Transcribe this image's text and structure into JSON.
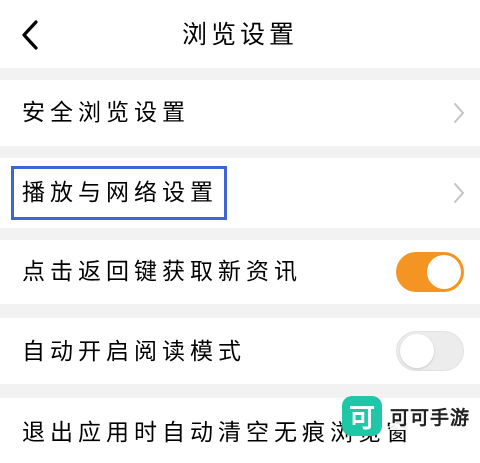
{
  "header": {
    "title": "浏览设置",
    "back_icon": "chevron-left-icon"
  },
  "settings": {
    "safe_browsing": {
      "label": "安全浏览设置",
      "icon": "chevron-right-icon"
    },
    "playback_network": {
      "label": "播放与网络设置",
      "icon": "chevron-right-icon"
    },
    "back_key_news": {
      "label": "点击返回键获取新资讯",
      "toggle_on": true
    },
    "auto_reading_mode": {
      "label": "自动开启阅读模式",
      "toggle_on": false
    },
    "exit_clear_incognito": {
      "label": "退出应用时自动清空无痕浏览窗"
    }
  },
  "highlight": {
    "color": "#3e64d6"
  },
  "watermark": {
    "logo_char": "可",
    "text": "可可手游"
  },
  "colors": {
    "toggle_on": "#f39423",
    "toggle_off": "#ececec",
    "section_gap": "#f2f2f2",
    "watermark_logo": "#1fc7a6"
  }
}
